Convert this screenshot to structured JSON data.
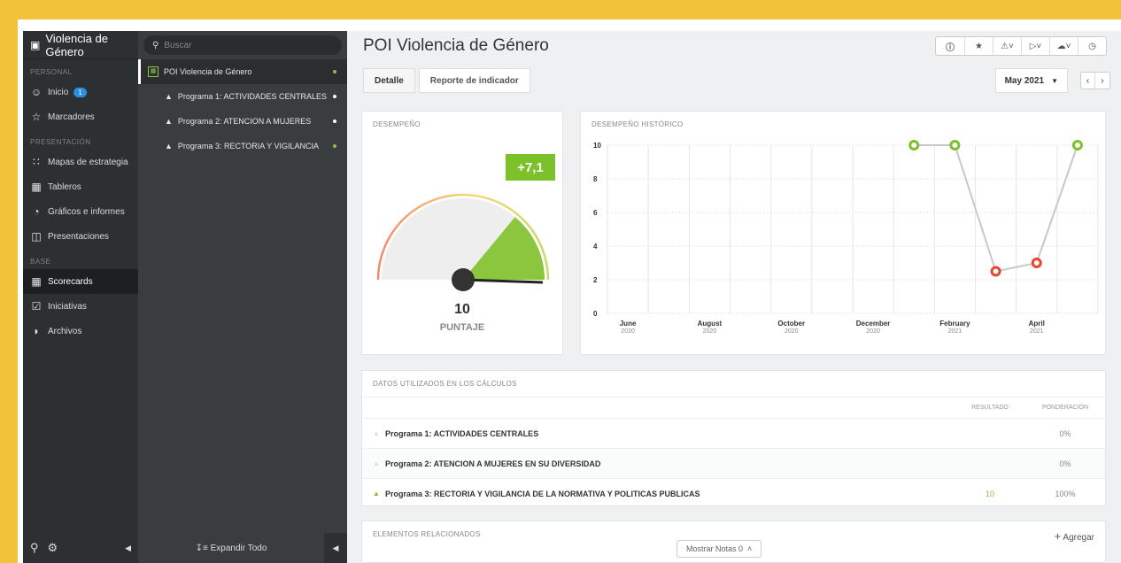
{
  "nav": {
    "title": "Violencia de Género",
    "sections": {
      "personal": "PERSONAL",
      "presentacion": "PRESENTACIÓN",
      "base": "BASE"
    },
    "items": [
      {
        "label": "Inicio",
        "icon": "user-icon"
      },
      {
        "label": "Marcadores",
        "icon": "star-icon"
      },
      {
        "label": "Mapas de estrategia",
        "icon": "strategy-map-icon"
      },
      {
        "label": "Tableros",
        "icon": "dashboard-icon"
      },
      {
        "label": "Gráficos e informes",
        "icon": "chart-icon"
      },
      {
        "label": "Presentaciones",
        "icon": "presentation-icon"
      },
      {
        "label": "Scorecards",
        "icon": "scorecard-icon"
      },
      {
        "label": "Iniciativas",
        "icon": "checkbox-icon"
      },
      {
        "label": "Archivos",
        "icon": "file-icon"
      }
    ],
    "inicio_badge": "1"
  },
  "tree": {
    "search_placeholder": "Buscar",
    "items": [
      {
        "label": "POI Violencia de Género",
        "status": "#8bc34a"
      },
      {
        "label": "Programa 1: ACTIVIDADES CENTRALES",
        "status": "#ffffff"
      },
      {
        "label": "Programa 2: ATENCION A MUJERES",
        "status": "#ffffff"
      },
      {
        "label": "Programa 3: RECTORIA Y VIGILANCIA",
        "status": "#8bc34a"
      }
    ],
    "expand_label": "Expandir Todo"
  },
  "main": {
    "title": "POI Violencia de Género",
    "toolbar": [
      "info-icon",
      "star-icon",
      "alert-icon",
      "export-icon",
      "cloud-icon",
      "clock-icon"
    ],
    "tabs": [
      "Detalle",
      "Reporte de indicador"
    ],
    "period": "May 2021",
    "performance": {
      "title": "DESEMPEÑO",
      "delta": "+7,1",
      "score": "10",
      "score_label": "PUNTAJE",
      "gauge_max": 10
    },
    "history_title": "DESEMPEÑO HISTÓRICO",
    "data_title": "DATOS UTILIZADOS EN LOS CÁLCULOS",
    "col_result": "RESULTADO",
    "col_weight": "PONDERACIÓN",
    "rows": [
      {
        "name": "Programa 1: ACTIVIDADES CENTRALES",
        "result": "",
        "weight": "0%",
        "status": "#dddddd"
      },
      {
        "name": "Programa 2: ATENCION A MUJERES EN SU DIVERSIDAD",
        "result": "",
        "weight": "0%",
        "status": "#dddddd"
      },
      {
        "name": "Programa 3: RECTORIA Y VIGILANCIA DE LA NORMATIVA Y POLITICAS PUBLICAS",
        "result": "10",
        "weight": "100%",
        "status": "#7cc12a"
      }
    ],
    "related_title": "ELEMENTOS RELACIONADOS",
    "add_label": "Agregar",
    "notes_label": "Mostrar Notas 0"
  },
  "chart_data": {
    "type": "line",
    "title": "DESEMPEÑO HISTÓRICO",
    "ylim": [
      0,
      10
    ],
    "yticks": [
      0,
      2,
      4,
      6,
      8,
      10
    ],
    "xticks": [
      {
        "month": "June",
        "year": "2020",
        "index": 0
      },
      {
        "month": "August",
        "year": "2020",
        "index": 2
      },
      {
        "month": "October",
        "year": "2020",
        "index": 4
      },
      {
        "month": "December",
        "year": "2020",
        "index": 6
      },
      {
        "month": "February",
        "year": "2021",
        "index": 8
      },
      {
        "month": "April",
        "year": "2021",
        "index": 10
      }
    ],
    "x_count": 12,
    "points": [
      {
        "x": "January 2021",
        "index": 7,
        "y": 10,
        "color": "#7cc12a"
      },
      {
        "x": "February 2021",
        "index": 8,
        "y": 10,
        "color": "#7cc12a"
      },
      {
        "x": "March 2021",
        "index": 9,
        "y": 2.5,
        "color": "#e8452c"
      },
      {
        "x": "April 2021",
        "index": 10,
        "y": 3,
        "color": "#e8452c"
      },
      {
        "x": "May 2021",
        "index": 11,
        "y": 10,
        "color": "#7cc12a"
      }
    ],
    "grid": true
  }
}
